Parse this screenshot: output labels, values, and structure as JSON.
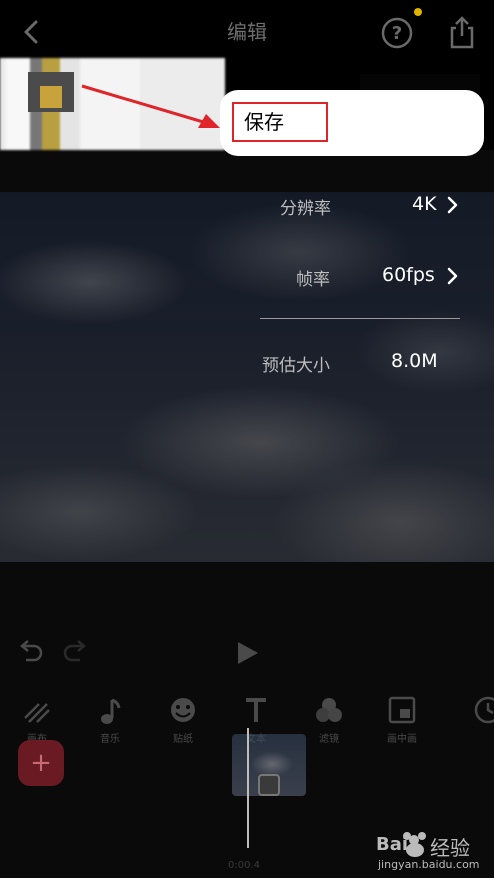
{
  "header": {
    "title": "编辑"
  },
  "callout": {
    "save_label": "保存"
  },
  "settings": {
    "resolution_label": "分辨率",
    "resolution_value": "4K",
    "framerate_label": "帧率",
    "framerate_value": "60fps",
    "size_label": "预估大小",
    "size_value": "8.0M"
  },
  "tools": [
    {
      "label": "画布",
      "icon": "hatch-icon"
    },
    {
      "label": "音乐",
      "icon": "music-note-icon"
    },
    {
      "label": "贴纸",
      "icon": "smiley-icon"
    },
    {
      "label": "文本",
      "icon": "text-icon"
    },
    {
      "label": "滤镜",
      "icon": "filter-icon"
    },
    {
      "label": "画中画",
      "icon": "pip-icon"
    },
    {
      "label": "",
      "icon": "clock-icon"
    }
  ],
  "timeline": {
    "timecode": "0:00.4"
  },
  "watermark": {
    "text": "经验",
    "url": "jingyan.baidu.com"
  },
  "colors": {
    "accent_dot": "#e0b300",
    "highlight_border": "#e0252a",
    "add_button": "#6a1a22"
  }
}
